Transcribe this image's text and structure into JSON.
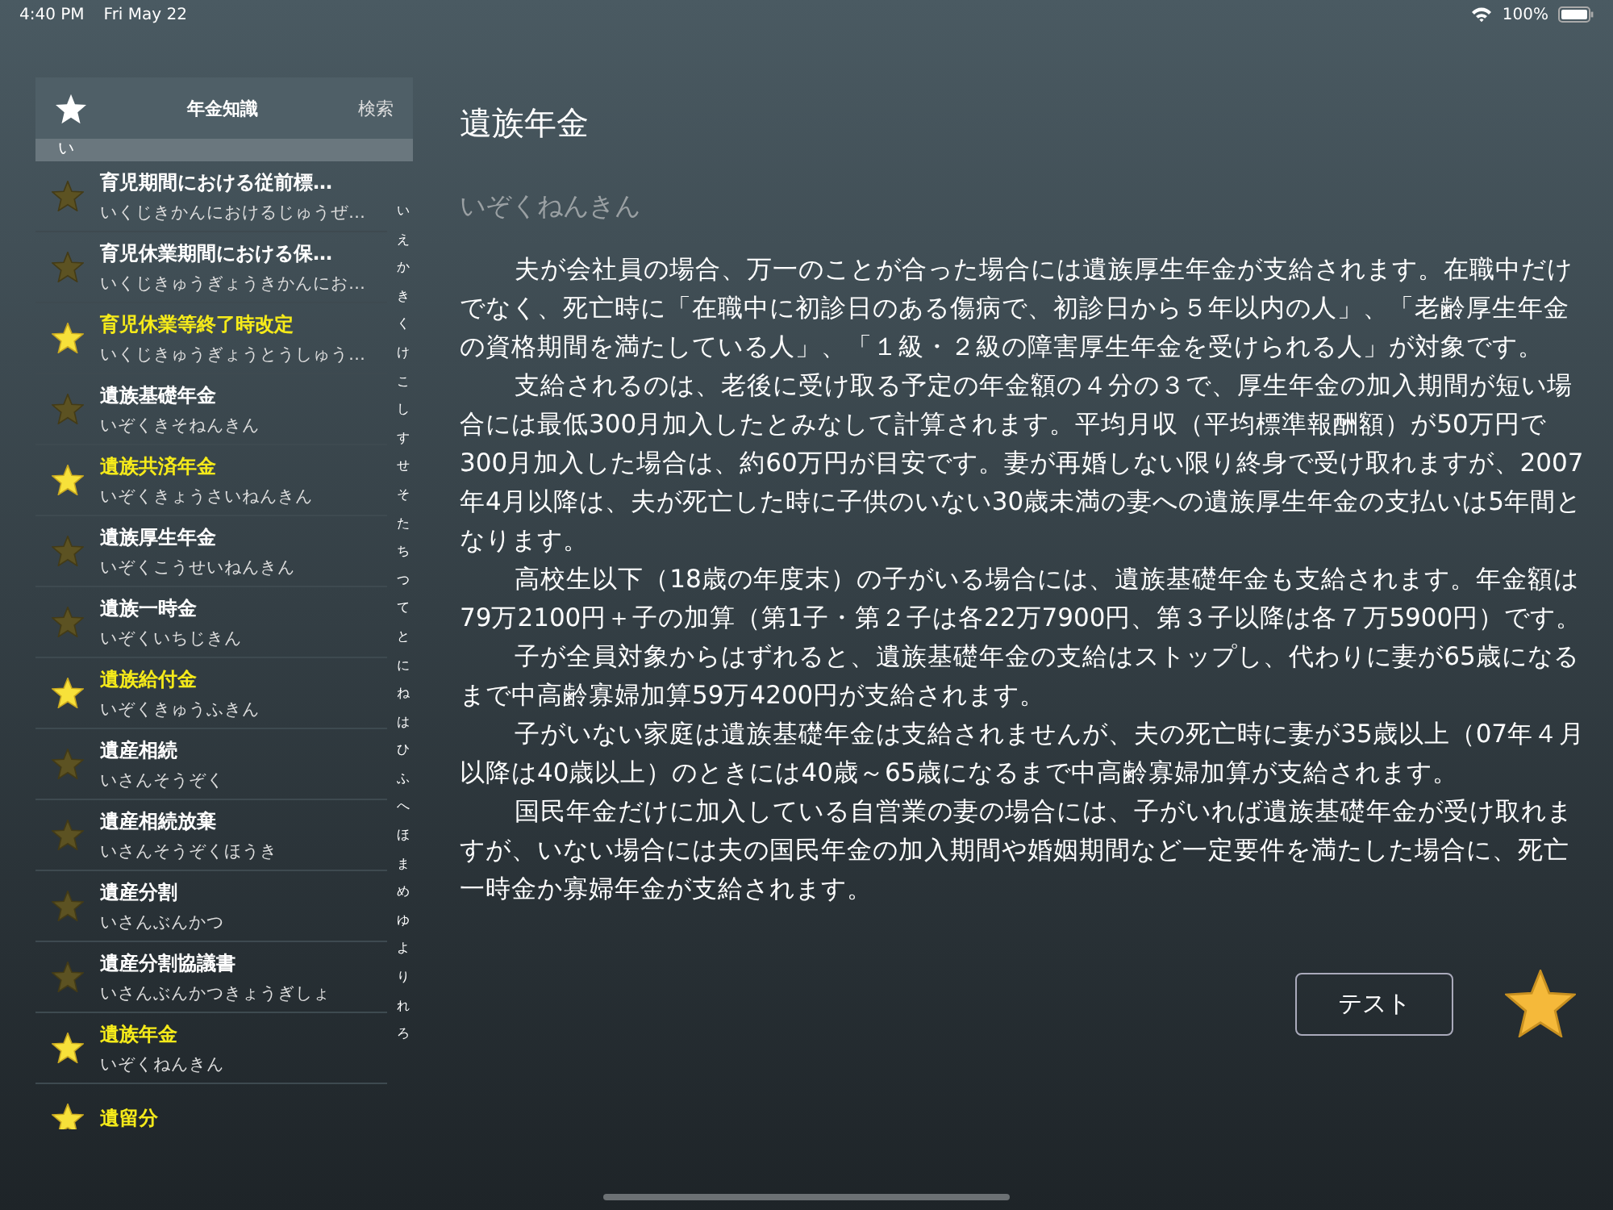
{
  "status_bar": {
    "time": "4:40 PM",
    "date": "Fri May 22",
    "battery": "100%"
  },
  "sidebar": {
    "title": "年金知識",
    "search": "検索",
    "section": "い",
    "items": [
      {
        "title": "育児期間における従前標…",
        "reading": "いくじきかんにおけるじゅうぜ…",
        "favorite": false
      },
      {
        "title": "育児休業期間における保…",
        "reading": "いくじきゅうぎょうきかんにお…",
        "favorite": false
      },
      {
        "title": "育児休業等終了時改定",
        "reading": "いくじきゅうぎょうとうしゅう…",
        "favorite": true
      },
      {
        "title": "遺族基礎年金",
        "reading": "いぞくきそねんきん",
        "favorite": false
      },
      {
        "title": "遺族共済年金",
        "reading": "いぞくきょうさいねんきん",
        "favorite": true
      },
      {
        "title": "遺族厚生年金",
        "reading": "いぞくこうせいねんきん",
        "favorite": false
      },
      {
        "title": "遺族一時金",
        "reading": "いぞくいちじきん",
        "favorite": false
      },
      {
        "title": "遺族給付金",
        "reading": "いぞくきゅうふきん",
        "favorite": true
      },
      {
        "title": "遺産相続",
        "reading": "いさんそうぞく",
        "favorite": false
      },
      {
        "title": "遺産相続放棄",
        "reading": "いさんそうぞくほうき",
        "favorite": false
      },
      {
        "title": "遺産分割",
        "reading": "いさんぶんかつ",
        "favorite": false
      },
      {
        "title": "遺産分割協議書",
        "reading": "いさんぶんかつきょうぎしょ",
        "favorite": false
      },
      {
        "title": "遺族年金",
        "reading": "いぞくねんきん",
        "favorite": true
      },
      {
        "title": "遺留分",
        "favorite": true
      }
    ],
    "index": [
      "い",
      "え",
      "か",
      "き",
      "く",
      "け",
      "こ",
      "し",
      "す",
      "せ",
      "そ",
      "た",
      "ち",
      "つ",
      "て",
      "と",
      "に",
      "ね",
      "は",
      "ひ",
      "ふ",
      "へ",
      "ほ",
      "ま",
      "め",
      "ゆ",
      "よ",
      "り",
      "れ",
      "ろ"
    ]
  },
  "article": {
    "title": "遺族年金",
    "reading": "いぞくねんきん",
    "paragraphs": [
      "夫が会社員の場合、万一のことが合った場合には遺族厚生年金が支給されます。在職中だけでなく、死亡時に「在職中に初診日のある傷病で、初診日から５年以内の人」、「老齢厚生年金の資格期間を満たしている人」、「１級・２級の障害厚生年金を受けられる人」が対象です。",
      "支給されるのは、老後に受け取る予定の年金額の４分の３で、厚生年金の加入期間が短い場合には最低300月加入したとみなして計算されます。平均月収（平均標準報酬額）が50万円で300月加入した場合は、約60万円が目安です。妻が再婚しない限り終身で受け取れますが、2007年4月以降は、夫が死亡した時に子供のいない30歳未満の妻への遺族厚生年金の支払いは5年間となります。",
      "高校生以下（18歳の年度末）の子がいる場合には、遺族基礎年金も支給されます。年金額は79万2100円＋子の加算（第1子・第２子は各22万7900円、第３子以降は各７万5900円）です。",
      "子が全員対象からはずれると、遺族基礎年金の支給はストップし、代わりに妻が65歳になるまで中高齢寡婦加算59万4200円が支給されます。",
      "子がいない家庭は遺族基礎年金は支給されませんが、夫の死亡時に妻が35歳以上（07年４月以降は40歳以上）のときには40歳～65歳になるまで中高齢寡婦加算が支給されます。",
      "国民年金だけに加入している自営業の妻の場合には、子がいれば遺族基礎年金が受け取れますが、いない場合には夫の国民年金の加入期間や婚姻期間など一定要件を満たした場合に、死亡一時金か寡婦年金が支給されます。"
    ],
    "test_button": "テスト",
    "favorite": true
  }
}
